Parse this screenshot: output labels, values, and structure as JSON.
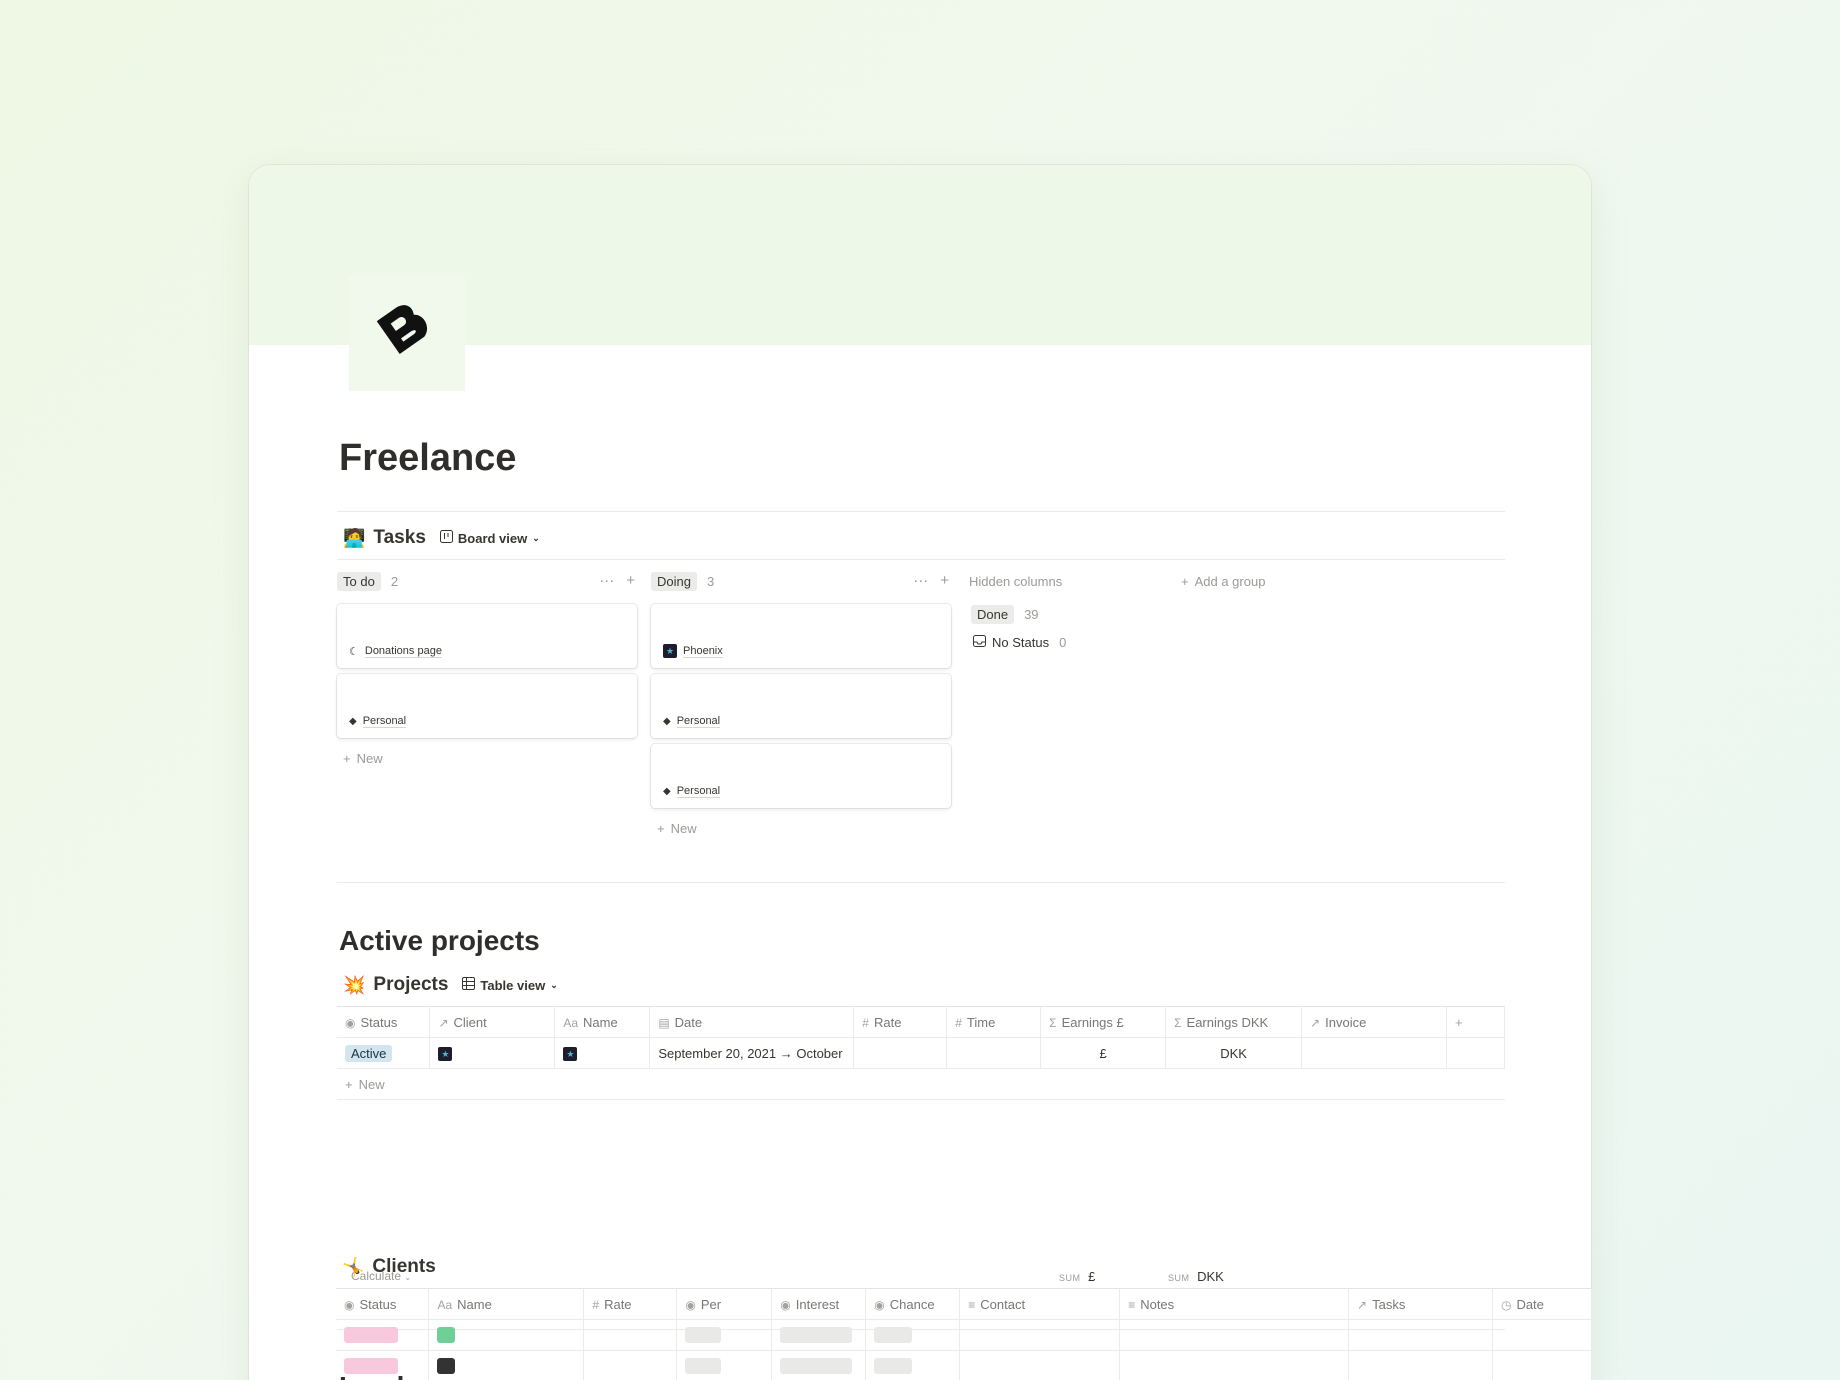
{
  "page": {
    "title": "Freelance",
    "icon": "b-logo-icon"
  },
  "tasks": {
    "emoji": "🧑‍💻",
    "title": "Tasks",
    "view_label": "Board view",
    "columns": [
      {
        "label": "To do",
        "count": "2",
        "cards": [
          {
            "label": "Donations page",
            "icon": "crescent-icon"
          },
          {
            "label": "Personal",
            "icon": "diamond-icon"
          }
        ],
        "new_label": "New"
      },
      {
        "label": "Doing",
        "count": "3",
        "cards": [
          {
            "label": "Phoenix",
            "icon": "star-avatar-icon"
          },
          {
            "label": "Personal",
            "icon": "diamond-icon"
          },
          {
            "label": "Personal",
            "icon": "diamond-icon"
          }
        ],
        "new_label": "New"
      }
    ],
    "hidden_columns_label": "Hidden columns",
    "add_group_label": "Add a group",
    "hidden_groups": [
      {
        "label": "Done",
        "count": "39"
      },
      {
        "label": "No Status",
        "count": "0"
      }
    ]
  },
  "active_projects": {
    "heading": "Active projects",
    "db_emoji": "💥",
    "db_title": "Projects",
    "view_label": "Table view",
    "columns": [
      "Status",
      "Client",
      "Name",
      "Date",
      "Rate",
      "Time",
      "Earnings £",
      "Earnings DKK",
      "Invoice"
    ],
    "rows": [
      {
        "status": "Active",
        "date": "September 20, 2021 → October",
        "earnings_gbp": "£",
        "earnings_dkk": "DKK"
      }
    ],
    "new_label": "New",
    "calculate_label": "Calculate",
    "sum_label": "SUM",
    "sum_gbp": "£",
    "sum_dkk": "DKK"
  },
  "leads": {
    "heading": "Leads",
    "db_emoji": "🤸",
    "db_title": "Clients",
    "columns": [
      "Status",
      "Name",
      "Rate",
      "Per",
      "Interest",
      "Chance",
      "Contact",
      "Notes",
      "Tasks",
      "Date"
    ],
    "status_color": "#f8c8dc",
    "name_colors": [
      "#6fcf97",
      "#333333"
    ]
  },
  "colors": {
    "accent_status": "#d3e5ef",
    "cover": "#eef8e8"
  }
}
